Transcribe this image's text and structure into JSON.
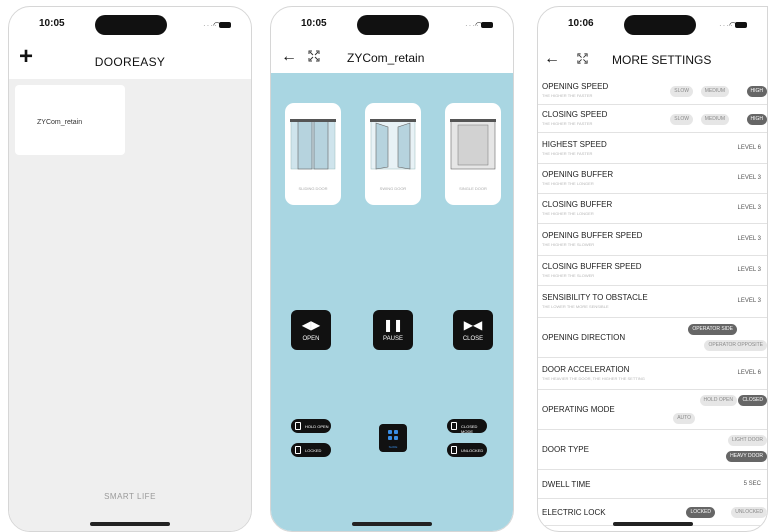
{
  "status_times": [
    "10:05",
    "10:05",
    "10:06"
  ],
  "home": {
    "title": "DOOREASY",
    "device_card": "ZYCom_retain",
    "footer": "SMART LIFE"
  },
  "device": {
    "title": "ZYCom_retain",
    "door_types": [
      "SLIDING DOOR",
      "SWING DOOR",
      "SINGLE DOOR"
    ],
    "controls": [
      {
        "icon": "open-arrows-icon",
        "label": "OPEN"
      },
      {
        "icon": "pause-icon",
        "label": "PAUSE"
      },
      {
        "icon": "close-arrows-icon",
        "label": "CLOSE"
      }
    ],
    "modes": {
      "hold_open": "HOLD OPEN",
      "closed_mode": "CLOSED MODE",
      "locked": "LOCKED",
      "unlocked": "UNLOCKED",
      "center": "SLIDE"
    }
  },
  "settings": {
    "title": "MORE SETTINGS",
    "rows": [
      {
        "name": "OPENING SPEED",
        "sub": "THE HIGHER THE FASTER",
        "chips": [
          {
            "t": "SLOW",
            "on": false
          },
          {
            "t": "MEDIUM",
            "on": false
          },
          {
            "t": "HIGH",
            "on": true
          }
        ]
      },
      {
        "name": "CLOSING SPEED",
        "sub": "THE HIGHER THE FASTER",
        "chips": [
          {
            "t": "SLOW",
            "on": false
          },
          {
            "t": "MEDIUM",
            "on": false
          },
          {
            "t": "HIGH",
            "on": true
          }
        ]
      },
      {
        "name": "HIGHEST SPEED",
        "sub": "THE HIGHER THE FASTER",
        "value": "LEVEL 6"
      },
      {
        "name": "OPENING BUFFER",
        "sub": "THE HIGHER THE LONGER",
        "value": "LEVEL 3"
      },
      {
        "name": "CLOSING BUFFER",
        "sub": "THE HIGHER THE LONGER",
        "value": "LEVEL 3"
      },
      {
        "name": "OPENING BUFFER SPEED",
        "sub": "THE HIGHER THE SLOWER",
        "value": "LEVEL 3"
      },
      {
        "name": "CLOSING BUFFER SPEED",
        "sub": "THE HIGHER THE SLOWER",
        "value": "LEVEL 3"
      },
      {
        "name": "SENSIBILITY TO OBSTACLE",
        "sub": "THE LOWER THE MORE SENSIBLE",
        "value": "LEVEL 3"
      },
      {
        "name": "OPENING DIRECTION",
        "sub": "",
        "chips": [
          {
            "t": "OPERATOR SIDE",
            "on": true
          },
          {
            "t": "OPERATOR OPPOSITE",
            "on": false
          }
        ]
      },
      {
        "name": "DOOR ACCELERATION",
        "sub": "THE HEAVIER THE DOOR, THE HIGHER THE SETTING",
        "value": "LEVEL 6"
      },
      {
        "name": "OPERATING MODE",
        "sub": "",
        "chips": [
          {
            "t": "HOLD OPEN",
            "on": false
          },
          {
            "t": "CLOSED",
            "on": true
          },
          {
            "t": "AUTO",
            "on": false
          }
        ]
      },
      {
        "name": "DOOR TYPE",
        "sub": "",
        "chips": [
          {
            "t": "LIGHT DOOR",
            "on": false
          },
          {
            "t": "HEAVY DOOR",
            "on": true
          }
        ]
      },
      {
        "name": "DWELL TIME",
        "sub": "",
        "value": "5 SEC"
      },
      {
        "name": "ELECTRIC LOCK",
        "sub": "",
        "chips": [
          {
            "t": "LOCKED",
            "on": true
          },
          {
            "t": "UNLOCKED",
            "on": false
          }
        ]
      }
    ]
  }
}
